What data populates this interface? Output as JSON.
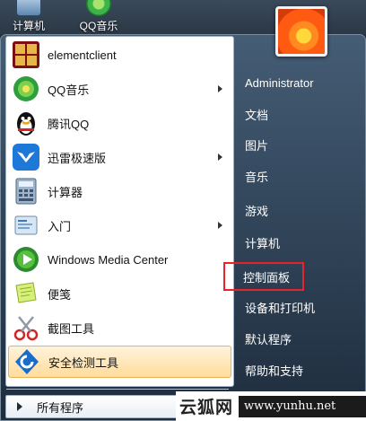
{
  "desktop": {
    "icons": [
      {
        "label": "计算机",
        "icon": "computer-icon",
        "color": "#8fb3d6"
      },
      {
        "label": "QQ音乐",
        "icon": "qq-music-icon",
        "color": "#3bb54a"
      }
    ]
  },
  "start_menu": {
    "programs": [
      {
        "label": "elementclient",
        "icon": "elementclient-icon",
        "submenu": false
      },
      {
        "label": "QQ音乐",
        "icon": "qq-music-icon",
        "submenu": true
      },
      {
        "label": "腾讯QQ",
        "icon": "qq-penguin-icon",
        "submenu": false
      },
      {
        "label": "迅雷极速版",
        "icon": "xunlei-icon",
        "submenu": true
      },
      {
        "label": "计算器",
        "icon": "calculator-icon",
        "submenu": false
      },
      {
        "label": "入门",
        "icon": "getting-started-icon",
        "submenu": true
      },
      {
        "label": "Windows Media Center",
        "icon": "media-center-icon",
        "submenu": false
      },
      {
        "label": "便笺",
        "icon": "sticky-notes-icon",
        "submenu": false
      },
      {
        "label": "截图工具",
        "icon": "snipping-tool-icon",
        "submenu": false
      },
      {
        "label": "安全检测工具",
        "icon": "security-tool-icon",
        "submenu": false,
        "selected": true
      }
    ],
    "all_programs": "所有程序",
    "right_items": [
      {
        "label": "Administrator"
      },
      {
        "label": "文档"
      },
      {
        "label": "图片"
      },
      {
        "label": "音乐"
      },
      {
        "label": "游戏"
      },
      {
        "label": "计算机"
      },
      {
        "label": "控制面板",
        "highlighted": true
      },
      {
        "label": "设备和打印机"
      },
      {
        "label": "默认程序"
      },
      {
        "label": "帮助和支持"
      }
    ],
    "highlight_color": "#e8232b"
  },
  "watermark": {
    "site_name": "云狐网",
    "url": "www.yunhu.net"
  }
}
